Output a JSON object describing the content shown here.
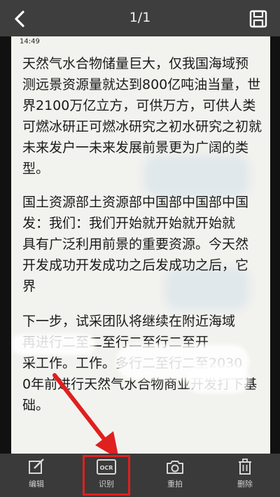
{
  "topbar": {
    "back_icon": "chevron-left-icon",
    "page_counter": "1/1",
    "save_icon": "save-icon"
  },
  "document": {
    "status_time": "14:49",
    "paragraphs": [
      [
        "天然气水合物储量巨大，仅我国海域预",
        "测远景资源量就达到800亿吨油当量，世",
        "界2100万亿立方，可供万方，可供人类",
        "可燃冰研正可燃冰研究之初水研究之初就",
        "未来发户一未来发展前景更为广阔的类",
        "型。"
      ],
      [
        "国土资源部土资源部中国部中国部中国",
        "发：我们：我们开始就开始就开始就",
        "具有广泛利用前景的重要资源。今天然",
        "开发成功开发成功之后发成功之后，它",
        "界"
      ],
      [
        "下一步，试采团队将继续在附近海域",
        "再进行二至二至行二至行二至开",
        "采工作。工作。多行二至行二至2030",
        "0年前进行天然气水合物商业开发打下基",
        "础。"
      ]
    ]
  },
  "toolbar": {
    "items": [
      {
        "label": "编辑",
        "icon": "edit-icon"
      },
      {
        "label": "识别",
        "icon": "ocr-icon",
        "badge": "OCR"
      },
      {
        "label": "重拍",
        "icon": "camera-icon"
      },
      {
        "label": "删除",
        "icon": "trash-icon"
      }
    ]
  },
  "colors": {
    "bar_bg": "#3a3a3a",
    "highlight": "#e01f1f",
    "paper": "#f2f2ee"
  }
}
